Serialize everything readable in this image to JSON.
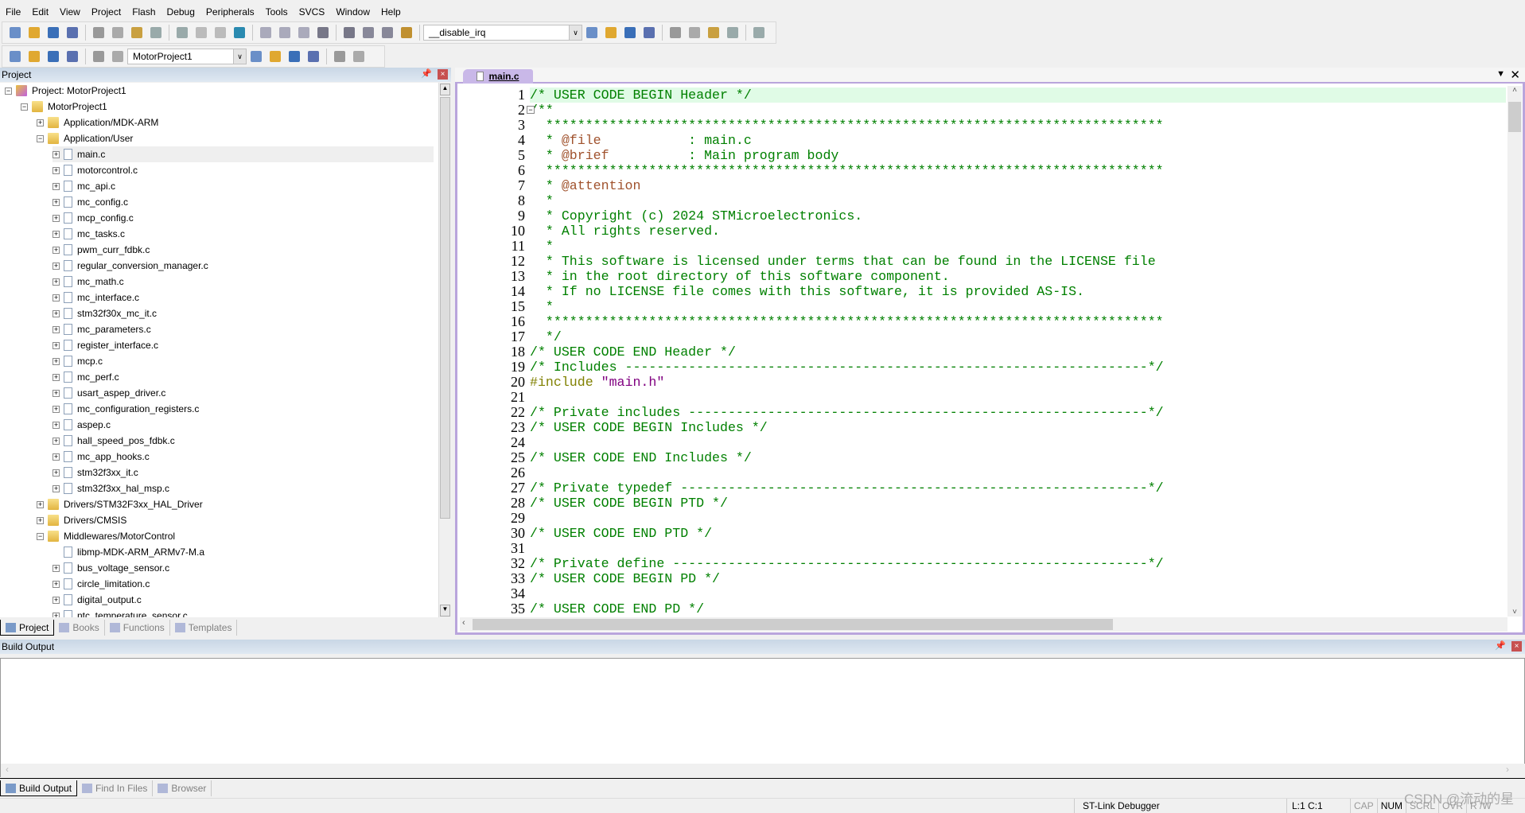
{
  "menu": [
    "File",
    "Edit",
    "View",
    "Project",
    "Flash",
    "Debug",
    "Peripherals",
    "Tools",
    "SVCS",
    "Window",
    "Help"
  ],
  "toolbar1": {
    "icons": [
      "new-file",
      "open-file",
      "save",
      "save-all",
      "cut",
      "copy",
      "paste",
      "undo",
      "redo",
      "nav-back",
      "nav-forward",
      "bookmark",
      "prev-bookmark",
      "next-bookmark",
      "clear-bookmarks",
      "indent",
      "unindent",
      "comment",
      "uncomment",
      "find-in-files"
    ],
    "find_value": "__disable_irq",
    "icons2": [
      "find",
      "incremental-find",
      "debug-session",
      "breakpoint",
      "disable-breakpoint",
      "disable-all-breakpoints",
      "kill-breakpoints",
      "window-layout",
      "configure"
    ]
  },
  "toolbar2": {
    "icons": [
      "translate",
      "build",
      "rebuild",
      "batch-build",
      "stop-build",
      "download"
    ],
    "target": "MotorProject1",
    "icons2": [
      "options-for-target",
      "manage-project",
      "select-packs",
      "manage-rte",
      "pack-installer",
      "manage-components"
    ]
  },
  "project_panel": {
    "title": "Project",
    "tree": [
      {
        "level": 0,
        "exp": "-",
        "icon": "project",
        "label": "Project: MotorProject1"
      },
      {
        "level": 1,
        "exp": "-",
        "icon": "target",
        "label": "MotorProject1"
      },
      {
        "level": 2,
        "exp": "+",
        "icon": "folder",
        "label": "Application/MDK-ARM"
      },
      {
        "level": 2,
        "exp": "-",
        "icon": "folder-open",
        "label": "Application/User"
      },
      {
        "level": 3,
        "exp": "+",
        "icon": "file",
        "label": "main.c",
        "selected": true
      },
      {
        "level": 3,
        "exp": "+",
        "icon": "file",
        "label": "motorcontrol.c"
      },
      {
        "level": 3,
        "exp": "+",
        "icon": "file",
        "label": "mc_api.c"
      },
      {
        "level": 3,
        "exp": "+",
        "icon": "file",
        "label": "mc_config.c"
      },
      {
        "level": 3,
        "exp": "+",
        "icon": "file",
        "label": "mcp_config.c"
      },
      {
        "level": 3,
        "exp": "+",
        "icon": "file",
        "label": "mc_tasks.c"
      },
      {
        "level": 3,
        "exp": "+",
        "icon": "file",
        "label": "pwm_curr_fdbk.c"
      },
      {
        "level": 3,
        "exp": "+",
        "icon": "file",
        "label": "regular_conversion_manager.c"
      },
      {
        "level": 3,
        "exp": "+",
        "icon": "file",
        "label": "mc_math.c"
      },
      {
        "level": 3,
        "exp": "+",
        "icon": "file",
        "label": "mc_interface.c"
      },
      {
        "level": 3,
        "exp": "+",
        "icon": "file",
        "label": "stm32f30x_mc_it.c"
      },
      {
        "level": 3,
        "exp": "+",
        "icon": "file",
        "label": "mc_parameters.c"
      },
      {
        "level": 3,
        "exp": "+",
        "icon": "file",
        "label": "register_interface.c"
      },
      {
        "level": 3,
        "exp": "+",
        "icon": "file",
        "label": "mcp.c"
      },
      {
        "level": 3,
        "exp": "+",
        "icon": "file",
        "label": "mc_perf.c"
      },
      {
        "level": 3,
        "exp": "+",
        "icon": "file",
        "label": "usart_aspep_driver.c"
      },
      {
        "level": 3,
        "exp": "+",
        "icon": "file",
        "label": "mc_configuration_registers.c"
      },
      {
        "level": 3,
        "exp": "+",
        "icon": "file",
        "label": "aspep.c"
      },
      {
        "level": 3,
        "exp": "+",
        "icon": "file",
        "label": "hall_speed_pos_fdbk.c"
      },
      {
        "level": 3,
        "exp": "+",
        "icon": "file",
        "label": "mc_app_hooks.c"
      },
      {
        "level": 3,
        "exp": "+",
        "icon": "file",
        "label": "stm32f3xx_it.c"
      },
      {
        "level": 3,
        "exp": "+",
        "icon": "file",
        "label": "stm32f3xx_hal_msp.c"
      },
      {
        "level": 2,
        "exp": "+",
        "icon": "folder",
        "label": "Drivers/STM32F3xx_HAL_Driver"
      },
      {
        "level": 2,
        "exp": "+",
        "icon": "folder",
        "label": "Drivers/CMSIS"
      },
      {
        "level": 2,
        "exp": "-",
        "icon": "folder-open",
        "label": "Middlewares/MotorControl"
      },
      {
        "level": 3,
        "exp": "",
        "icon": "file",
        "label": "libmp-MDK-ARM_ARMv7-M.a"
      },
      {
        "level": 3,
        "exp": "+",
        "icon": "file",
        "label": "bus_voltage_sensor.c"
      },
      {
        "level": 3,
        "exp": "+",
        "icon": "file",
        "label": "circle_limitation.c"
      },
      {
        "level": 3,
        "exp": "+",
        "icon": "file",
        "label": "digital_output.c"
      },
      {
        "level": 3,
        "exp": "+",
        "icon": "file",
        "label": "ntc_temperature_sensor.c"
      }
    ],
    "tabs": [
      {
        "label": "Project",
        "icon": "project-tab-icon",
        "active": true
      },
      {
        "label": "Books",
        "icon": "books-icon"
      },
      {
        "label": "Functions",
        "icon": "functions-icon"
      },
      {
        "label": "Templates",
        "icon": "templates-icon"
      }
    ]
  },
  "editor": {
    "tab": "main.c",
    "highlight_line": 1,
    "lines": [
      [
        [
          "/* USER CODE BEGIN Header */",
          "c"
        ]
      ],
      [
        [
          "/**",
          "c"
        ]
      ],
      [
        [
          "  ******************************************************************************",
          "c"
        ]
      ],
      [
        [
          "  * ",
          "c"
        ],
        [
          "@file",
          "d"
        ],
        [
          "           : main.c",
          "c"
        ]
      ],
      [
        [
          "  * ",
          "c"
        ],
        [
          "@brief",
          "d"
        ],
        [
          "          : Main program body",
          "c"
        ]
      ],
      [
        [
          "  ******************************************************************************",
          "c"
        ]
      ],
      [
        [
          "  * ",
          "c"
        ],
        [
          "@attention",
          "d"
        ]
      ],
      [
        [
          "  *",
          "c"
        ]
      ],
      [
        [
          "  * Copyright (c) 2024 STMicroelectronics.",
          "c"
        ]
      ],
      [
        [
          "  * All rights reserved.",
          "c"
        ]
      ],
      [
        [
          "  *",
          "c"
        ]
      ],
      [
        [
          "  * This software is licensed under terms that can be found in the LICENSE file",
          "c"
        ]
      ],
      [
        [
          "  * in the root directory of this software component.",
          "c"
        ]
      ],
      [
        [
          "  * If no LICENSE file comes with this software, it is provided AS-IS.",
          "c"
        ]
      ],
      [
        [
          "  *",
          "c"
        ]
      ],
      [
        [
          "  ******************************************************************************",
          "c"
        ]
      ],
      [
        [
          "  */",
          "c"
        ]
      ],
      [
        [
          "/* USER CODE END Header */",
          "c"
        ]
      ],
      [
        [
          "/* Includes ------------------------------------------------------------------*/",
          "c"
        ]
      ],
      [
        [
          "#include ",
          "p"
        ],
        [
          "\"main.h\"",
          "s"
        ]
      ],
      [],
      [
        [
          "/* Private includes ----------------------------------------------------------*/",
          "c"
        ]
      ],
      [
        [
          "/* USER CODE BEGIN Includes */",
          "c"
        ]
      ],
      [],
      [
        [
          "/* USER CODE END Includes */",
          "c"
        ]
      ],
      [],
      [
        [
          "/* Private typedef -----------------------------------------------------------*/",
          "c"
        ]
      ],
      [
        [
          "/* USER CODE BEGIN PTD */",
          "c"
        ]
      ],
      [],
      [
        [
          "/* USER CODE END PTD */",
          "c"
        ]
      ],
      [],
      [
        [
          "/* Private define ------------------------------------------------------------*/",
          "c"
        ]
      ],
      [
        [
          "/* USER CODE BEGIN PD */",
          "c"
        ]
      ],
      [],
      [
        [
          "/* USER CODE END PD */",
          "c"
        ]
      ]
    ]
  },
  "build_output": {
    "title": "Build Output",
    "text": "",
    "tabs": [
      {
        "label": "Build Output",
        "icon": "build-output-icon",
        "active": true
      },
      {
        "label": "Find In Files",
        "icon": "find-in-files-icon"
      },
      {
        "label": "Browser",
        "icon": "browser-icon"
      }
    ]
  },
  "status": {
    "debugger": "ST-Link Debugger",
    "position": "L:1 C:1",
    "indicators": [
      "CAP",
      "NUM",
      "SCRL",
      "OVR",
      "R /W"
    ],
    "active_indicator": "NUM"
  },
  "watermark": "CSDN @流动的星",
  "colors": {
    "comment": "#008000",
    "doc_tag": "#a0522d",
    "preprocessor": "#808000",
    "string": "#800080",
    "current_line": "#e0fbe6",
    "editor_frame": "#b9a5dc"
  }
}
